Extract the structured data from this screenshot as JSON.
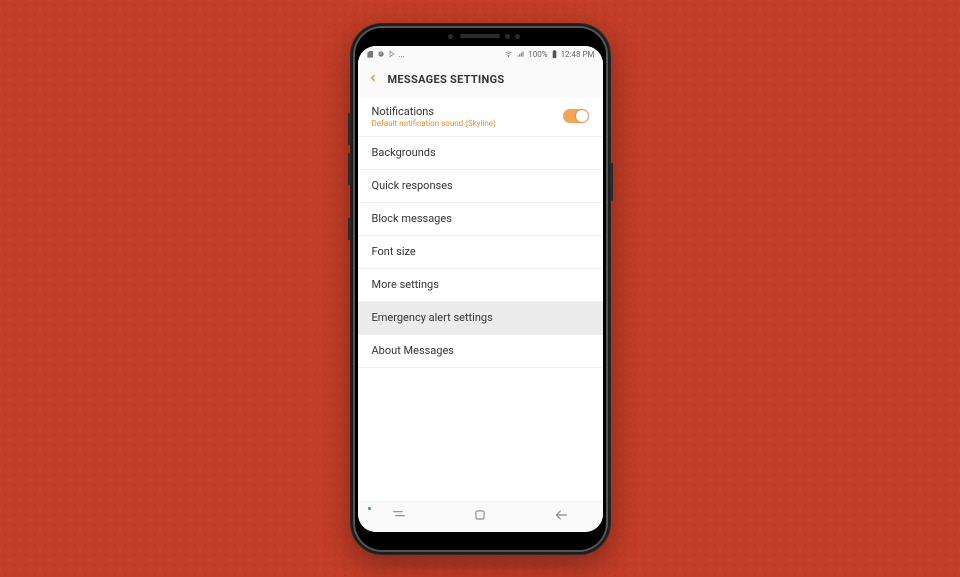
{
  "status_bar": {
    "left_text": "...",
    "signal_label": "100%",
    "time": "12:48 PM"
  },
  "header": {
    "title": "MESSAGES SETTINGS"
  },
  "settings": {
    "notifications": {
      "title": "Notifications",
      "subtitle": "Default notification sound (Skyline)",
      "toggle_on": true
    },
    "items": [
      {
        "title": "Backgrounds",
        "highlight": false
      },
      {
        "title": "Quick responses",
        "highlight": false
      },
      {
        "title": "Block messages",
        "highlight": false
      },
      {
        "title": "Font size",
        "highlight": false
      },
      {
        "title": "More settings",
        "highlight": false
      },
      {
        "title": "Emergency alert settings",
        "highlight": true
      },
      {
        "title": "About Messages",
        "highlight": false
      }
    ]
  },
  "colors": {
    "accent": "#ef8a2c",
    "background": "#c33d27"
  }
}
